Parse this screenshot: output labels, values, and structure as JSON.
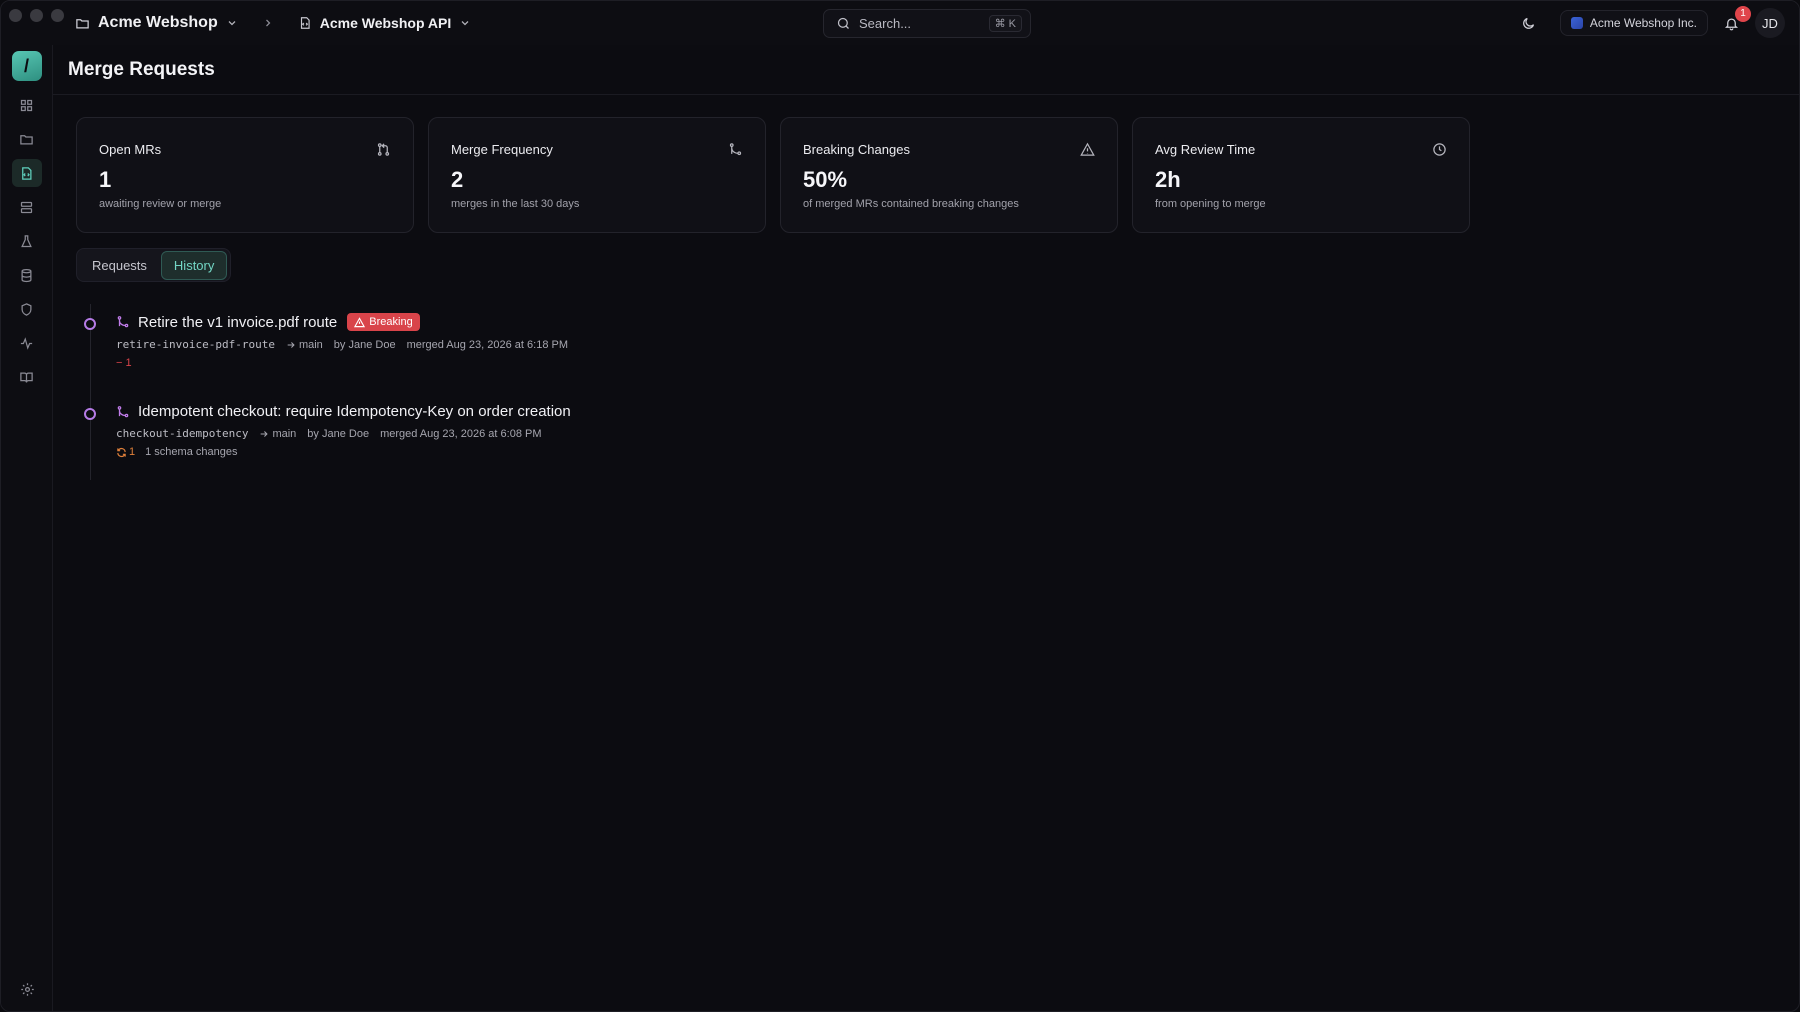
{
  "topbar": {
    "project": "Acme Webshop",
    "api": "Acme Webshop API",
    "search_placeholder": "Search...",
    "search_shortcut": "⌘ K",
    "org": "Acme Webshop Inc.",
    "notification_count": "1",
    "user_initials": "JD"
  },
  "sidebar": {
    "logo": "/",
    "items": [
      "dashboard-icon",
      "folder-icon",
      "api-icon",
      "server-icon",
      "flask-icon",
      "database-icon",
      "shield-icon",
      "activity-icon",
      "book-icon"
    ]
  },
  "page": {
    "title": "Merge Requests"
  },
  "stats": [
    {
      "label": "Open MRs",
      "value": "1",
      "sub": "awaiting review or merge",
      "icon": "pull-request-icon"
    },
    {
      "label": "Merge Frequency",
      "value": "2",
      "sub": "merges in the last 30 days",
      "icon": "merge-icon"
    },
    {
      "label": "Breaking Changes",
      "value": "50%",
      "sub": "of merged MRs contained breaking changes",
      "icon": "warning-icon"
    },
    {
      "label": "Avg Review Time",
      "value": "2h",
      "sub": "from opening to merge",
      "icon": "clock-icon"
    }
  ],
  "tabs": [
    {
      "label": "Requests",
      "active": false
    },
    {
      "label": "History",
      "active": true
    }
  ],
  "history": [
    {
      "title": "Retire the v1 invoice.pdf route",
      "badge": "Breaking",
      "branch": "retire-invoice-pdf-route",
      "target": "main",
      "author": "by Jane Doe",
      "merged": "merged Aug 23, 2026 at 6:18 PM",
      "removed": "− 1"
    },
    {
      "title": "Idempotent checkout: require Idempotency-Key on order creation",
      "branch": "checkout-idempotency",
      "target": "main",
      "author": "by Jane Doe",
      "merged": "merged Aug 23, 2026 at 6:08 PM",
      "modified": "1",
      "changes_label": "1 schema changes"
    }
  ]
}
